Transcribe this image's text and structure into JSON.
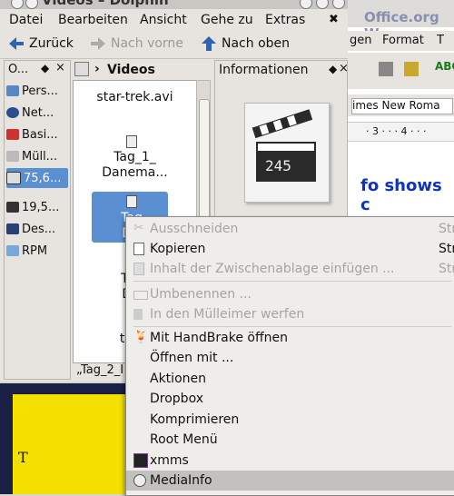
{
  "window": {
    "title": "Videos – Dolphin"
  },
  "menubar": [
    {
      "label": "Datei"
    },
    {
      "label": "Bearbeiten"
    },
    {
      "label": "Ansicht"
    },
    {
      "label": "Gehe zu"
    },
    {
      "label": "Extras"
    }
  ],
  "toolbar": {
    "back": "Zurück",
    "forward": "Nach vorne",
    "up": "Nach oben"
  },
  "places": {
    "header": "O...",
    "items": [
      {
        "label": "Pers..."
      },
      {
        "label": "Net..."
      },
      {
        "label": "Basi..."
      },
      {
        "label": "Müll..."
      },
      {
        "label": "75,6..."
      },
      {
        "label": "19,5..."
      },
      {
        "label": "Des..."
      },
      {
        "label": "RPM"
      }
    ]
  },
  "files": {
    "breadcrumb": "Videos",
    "items": [
      {
        "label1": "star-trek.avi",
        "label2": ""
      },
      {
        "label1": "Tag_1_",
        "label2": "Danema..."
      },
      {
        "label1": "Tag_",
        "label2": "Dan"
      },
      {
        "label1": "Tag_",
        "label2": "Dan"
      },
      {
        "label1": "term",
        "label2": "IV"
      }
    ],
    "status": "„Tag_2_I"
  },
  "info": {
    "title": "Informationen",
    "thumb_text": "245"
  },
  "openoffice": {
    "title": "Office.org W",
    "menu": [
      "gen",
      "Format",
      "T"
    ],
    "font": "imes New Roma",
    "ruler": "· 3 · · · 4 · · ·",
    "doc_text": "fo shows c"
  },
  "desktop": {
    "glyph": "T"
  },
  "context_menu": {
    "items": [
      {
        "label": "Ausschneiden",
        "shortcut": "Str",
        "disabled": true
      },
      {
        "label": "Kopieren",
        "shortcut": "Str",
        "disabled": false
      },
      {
        "label": "Inhalt der Zwischenablage einfügen ...",
        "shortcut": "Str",
        "disabled": true
      },
      {
        "label": "Umbenennen ...",
        "shortcut": "",
        "disabled": true
      },
      {
        "label": "In den Mülleimer werfen",
        "shortcut": "",
        "disabled": true
      },
      {
        "label": "Mit HandBrake öffnen",
        "shortcut": "",
        "disabled": false
      },
      {
        "label": "Öffnen mit ...",
        "shortcut": "",
        "disabled": false
      },
      {
        "label": "Aktionen",
        "shortcut": "",
        "disabled": false
      },
      {
        "label": "Dropbox",
        "shortcut": "",
        "disabled": false
      },
      {
        "label": "Komprimieren",
        "shortcut": "",
        "disabled": false
      },
      {
        "label": "Root Menü",
        "shortcut": "",
        "disabled": false
      },
      {
        "label": "xmms",
        "shortcut": "",
        "disabled": false
      },
      {
        "label": "MediaInfo",
        "shortcut": "",
        "disabled": false,
        "highlighted": true
      }
    ]
  }
}
